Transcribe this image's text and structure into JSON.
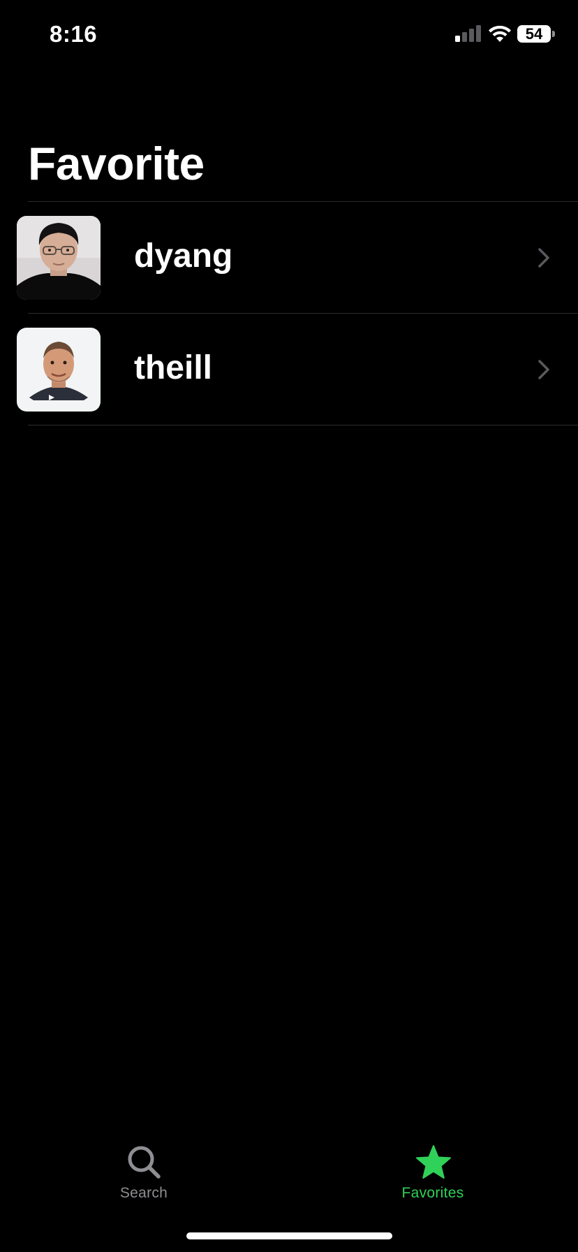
{
  "status_bar": {
    "time": "8:16",
    "battery_level": "54",
    "signal_icon": "cellular-signal-icon",
    "wifi_icon": "wifi-icon"
  },
  "header": {
    "title": "Favorite"
  },
  "favorites": [
    {
      "username": "dyang",
      "avatar_icon": "user-photo"
    },
    {
      "username": "theill",
      "avatar_icon": "user-photo"
    }
  ],
  "tab_bar": {
    "tabs": [
      {
        "label": "Search",
        "icon": "search-icon",
        "selected": false
      },
      {
        "label": "Favorites",
        "icon": "star-icon",
        "selected": true
      }
    ]
  },
  "colors": {
    "background": "#000000",
    "accent": "#30D158",
    "inactive_tab": "#8E8E93",
    "separator": "#2C2C2E"
  }
}
